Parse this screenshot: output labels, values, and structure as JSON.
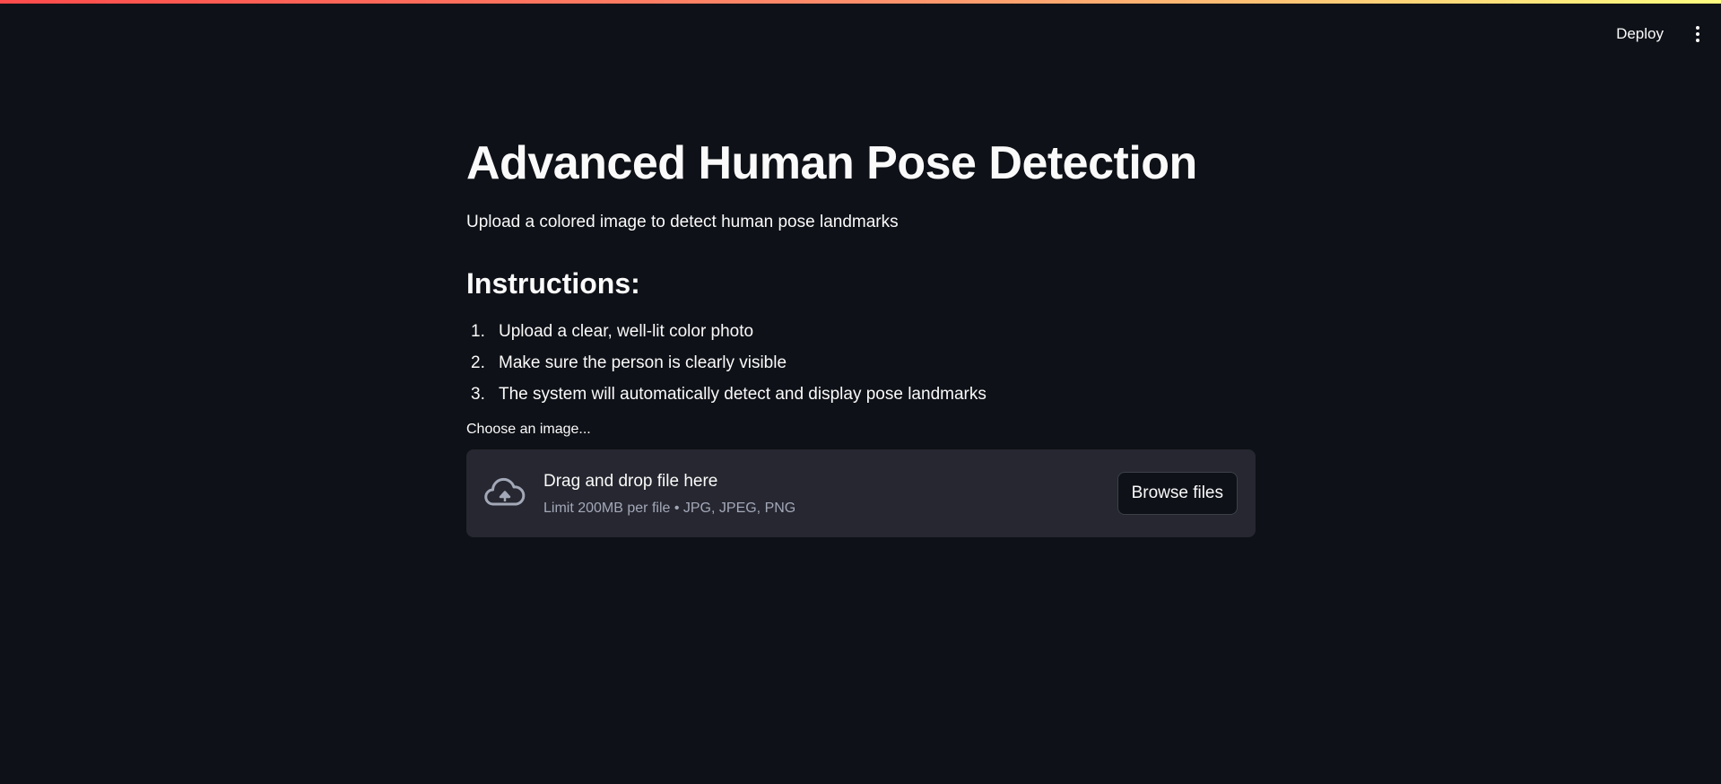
{
  "header": {
    "deploy_label": "Deploy",
    "menu_icon": "more-vertical-icon"
  },
  "main": {
    "title": "Advanced Human Pose Detection",
    "subtitle": "Upload a colored image to detect human pose landmarks",
    "instructions_heading": "Instructions:",
    "instructions": [
      {
        "num": "1.",
        "text": "Upload a clear, well-lit color photo"
      },
      {
        "num": "2.",
        "text": "Make sure the person is clearly visible"
      },
      {
        "num": "3.",
        "text": "The system will automatically detect and display pose landmarks"
      }
    ]
  },
  "uploader": {
    "label": "Choose an image...",
    "icon": "cloud-upload-icon",
    "drop_title": "Drag and drop file here",
    "limit_text": "Limit 200MB per file • JPG, JPEG, PNG",
    "browse_label": "Browse files"
  },
  "colors": {
    "background": "#0e1117",
    "dropzone": "#262730",
    "text": "#fafafa",
    "muted_text": "#a3a8b8",
    "accent_gradient": [
      "#ff4b4b",
      "#fffd80"
    ]
  }
}
